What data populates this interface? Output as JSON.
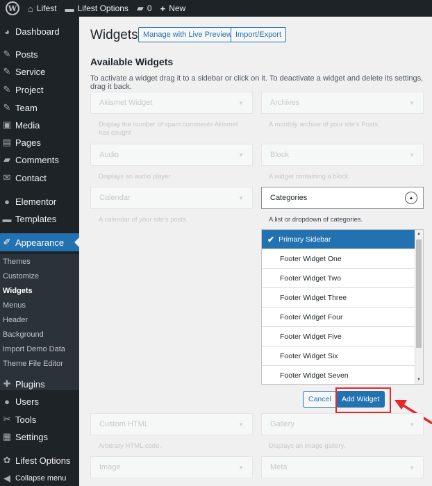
{
  "adminbar": {
    "site_name": "Lifest",
    "options": "Lifest Options",
    "comments_count": "0",
    "new_label": "New"
  },
  "sidebar": {
    "items": [
      {
        "label": "Dashboard",
        "icon": "dashboard-icon",
        "glyph": "◕"
      },
      {
        "label": "Posts",
        "icon": "pin-icon",
        "glyph": "✎"
      },
      {
        "label": "Service",
        "icon": "pin-icon",
        "glyph": "✎"
      },
      {
        "label": "Project",
        "icon": "pin-icon",
        "glyph": "✎"
      },
      {
        "label": "Team",
        "icon": "pin-icon",
        "glyph": "✎"
      },
      {
        "label": "Media",
        "icon": "media-icon",
        "glyph": "▣"
      },
      {
        "label": "Pages",
        "icon": "pages-icon",
        "glyph": "▤"
      },
      {
        "label": "Comments",
        "icon": "comment-icon",
        "glyph": "▰"
      },
      {
        "label": "Contact",
        "icon": "mail-icon",
        "glyph": "✉"
      },
      {
        "label": "Elementor",
        "icon": "elementor-icon",
        "glyph": "●"
      },
      {
        "label": "Templates",
        "icon": "folder-icon",
        "glyph": "▬"
      },
      {
        "label": "Appearance",
        "icon": "brush-icon",
        "glyph": "✐"
      },
      {
        "label": "Plugins",
        "icon": "plugin-icon",
        "glyph": "✚"
      },
      {
        "label": "Users",
        "icon": "user-icon",
        "glyph": "●"
      },
      {
        "label": "Tools",
        "icon": "wrench-icon",
        "glyph": "✂"
      },
      {
        "label": "Settings",
        "icon": "settings-icon",
        "glyph": "▦"
      },
      {
        "label": "Lifest Options",
        "icon": "gear-icon",
        "glyph": "✿"
      },
      {
        "label": "Collapse menu",
        "icon": "collapse-icon",
        "glyph": "◀"
      }
    ],
    "submenu": [
      {
        "label": "Themes"
      },
      {
        "label": "Customize"
      },
      {
        "label": "Widgets"
      },
      {
        "label": "Menus"
      },
      {
        "label": "Header"
      },
      {
        "label": "Background"
      },
      {
        "label": "Import Demo Data"
      },
      {
        "label": "Theme File Editor"
      }
    ]
  },
  "page": {
    "title": "Widgets",
    "manage_button": "Manage with Live Preview",
    "import_button": "Import/Export",
    "section_title": "Available Widgets",
    "description": "To activate a widget drag it to a sidebar or click on it. To deactivate a widget and delete its settings, drag it back."
  },
  "widgets": {
    "akismet": {
      "title": "Akismet Widget",
      "desc": "Display the number of spam comments Akismet has caught"
    },
    "archives": {
      "title": "Archives",
      "desc": "A monthly archive of your site's Posts."
    },
    "audio": {
      "title": "Audio",
      "desc": "Displays an audio player."
    },
    "block": {
      "title": "Block",
      "desc": "A widget containing a block."
    },
    "calendar": {
      "title": "Calendar",
      "desc": "A calendar of your site's posts."
    },
    "categories": {
      "title": "Categories",
      "desc": "A list or dropdown of categories."
    },
    "custom_html": {
      "title": "Custom HTML",
      "desc": "Arbitrary HTML code."
    },
    "gallery": {
      "title": "Gallery",
      "desc": "Displays an image gallery."
    },
    "image": {
      "title": "Image"
    },
    "meta": {
      "title": "Meta"
    }
  },
  "sidebar_choices": [
    "Primary Sidebar",
    "Footer Widget One",
    "Footer Widget Two",
    "Footer Widget Three",
    "Footer Widget Four",
    "Footer Widget Five",
    "Footer Widget Six",
    "Footer Widget Seven"
  ],
  "actions": {
    "cancel": "Cancel",
    "add_widget": "Add Widget"
  },
  "colors": {
    "admin_dark": "#1d2327",
    "accent": "#2271b1",
    "highlight": "#e62828"
  }
}
